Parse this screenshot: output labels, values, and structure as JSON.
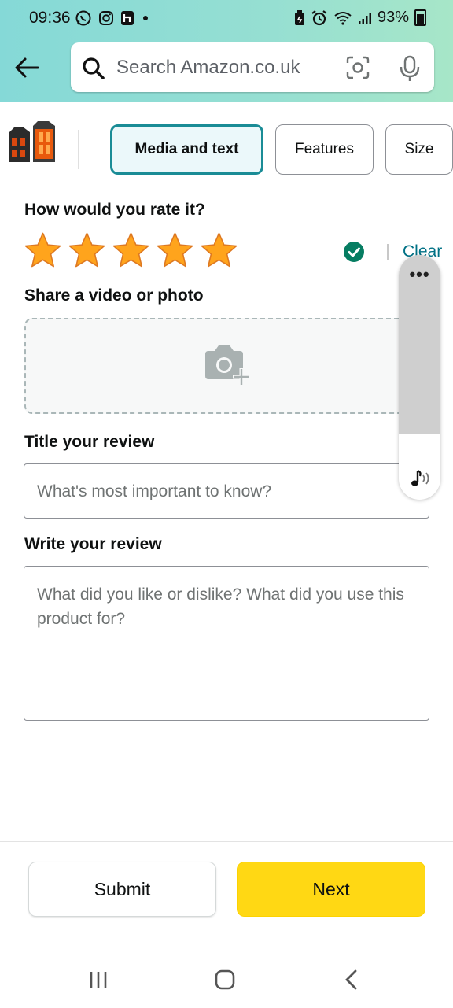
{
  "status_bar": {
    "time": "09:36",
    "battery": "93%",
    "left_icons": [
      "whatsapp-icon",
      "instagram-icon",
      "app-icon",
      "dot-icon"
    ],
    "right_icons": [
      "battery-saver-icon",
      "alarm-icon",
      "wifi-icon",
      "signal-icon",
      "battery-icon"
    ]
  },
  "header": {
    "search_placeholder": "Search Amazon.co.uk"
  },
  "tabs": [
    {
      "label": "Media and text",
      "active": true
    },
    {
      "label": "Features",
      "active": false
    },
    {
      "label": "Size",
      "active": false
    }
  ],
  "rating": {
    "label": "How would you rate it?",
    "value": 5,
    "max": 5,
    "clear_label": "Clear"
  },
  "media": {
    "label": "Share a video or photo"
  },
  "title_field": {
    "label": "Title your review",
    "placeholder": "What's most important to know?"
  },
  "review_field": {
    "label": "Write your review",
    "placeholder": "What did you like or dislike? What did you use this product for?"
  },
  "side_panel": {
    "menu_label": "•••"
  },
  "footer": {
    "submit_label": "Submit",
    "next_label": "Next"
  },
  "colors": {
    "accent": "#1a8c96",
    "star": "#ffa41c",
    "next_button": "#ffd814",
    "link": "#007185",
    "check": "#067d62"
  }
}
